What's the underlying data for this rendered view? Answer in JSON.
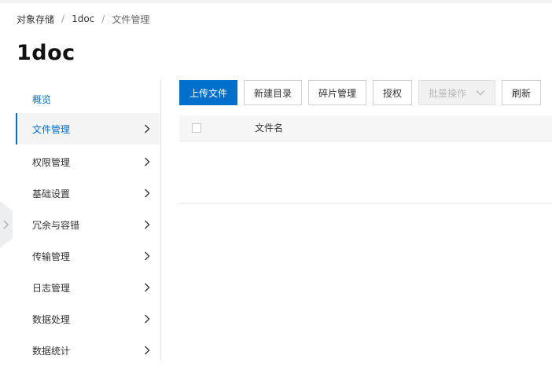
{
  "breadcrumb": {
    "items": [
      "对象存储",
      "1doc",
      "文件管理"
    ],
    "separator": "/"
  },
  "page": {
    "title": "1doc"
  },
  "sidebar": {
    "items": [
      {
        "label": "概览",
        "has_chevron": false,
        "state": "link"
      },
      {
        "label": "文件管理",
        "has_chevron": true,
        "state": "active"
      },
      {
        "label": "权限管理",
        "has_chevron": true,
        "state": "normal"
      },
      {
        "label": "基础设置",
        "has_chevron": true,
        "state": "normal"
      },
      {
        "label": "冗余与容错",
        "has_chevron": true,
        "state": "normal"
      },
      {
        "label": "传输管理",
        "has_chevron": true,
        "state": "normal"
      },
      {
        "label": "日志管理",
        "has_chevron": true,
        "state": "normal"
      },
      {
        "label": "数据处理",
        "has_chevron": true,
        "state": "normal"
      },
      {
        "label": "数据统计",
        "has_chevron": true,
        "state": "normal"
      }
    ]
  },
  "toolbar": {
    "upload_label": "上传文件",
    "new_dir_label": "新建目录",
    "fragments_label": "碎片管理",
    "authorize_label": "授权",
    "batch_label": "批量操作",
    "refresh_label": "刷新"
  },
  "table": {
    "columns": [
      "文件名"
    ],
    "rows": []
  },
  "icons": {
    "sidebar_chevron": "chevron-right-icon",
    "batch_dropdown": "chevron-down-icon",
    "collapse": "chevron-right-icon"
  },
  "colors": {
    "accent": "#0070cc",
    "text": "#333333",
    "border": "#d0d0d0",
    "disabled_bg": "#f1f1f1",
    "disabled_text": "#b9b9b9",
    "header_bg": "#f6f6f6"
  }
}
